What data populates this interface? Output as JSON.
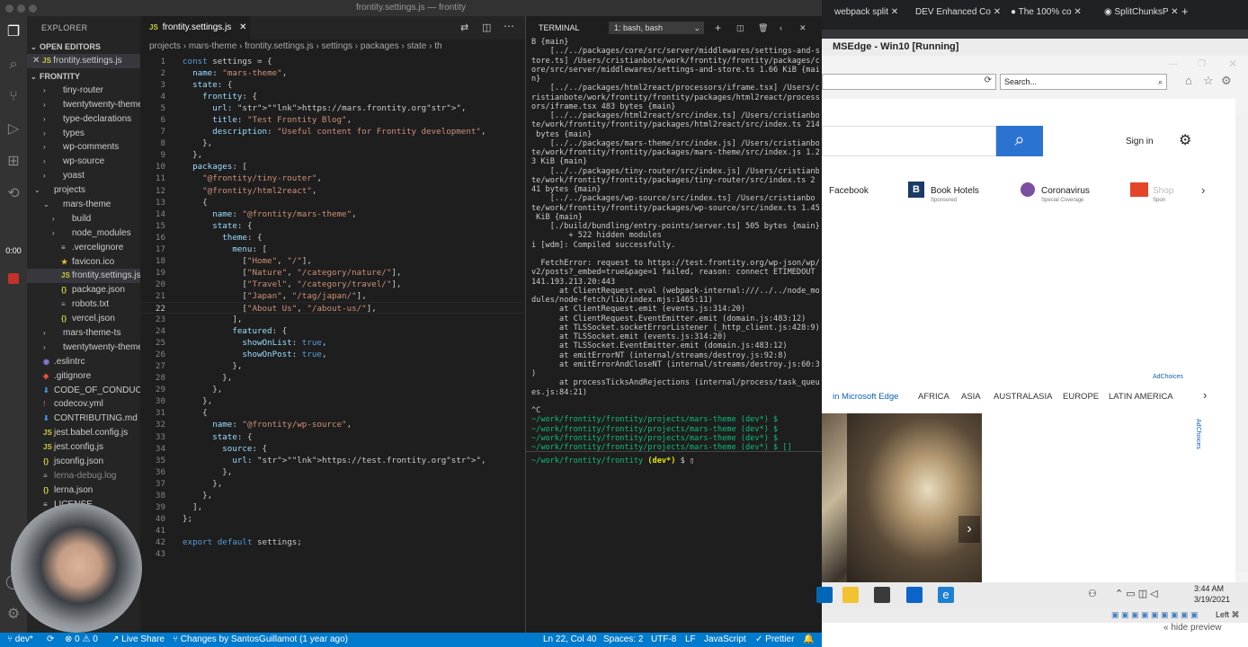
{
  "window_title": "frontity.settings.js — frontity",
  "explorer": {
    "title": "EXPLORER",
    "open_editors_label": "OPEN EDITORS",
    "open_editor_file": "frontity.settings.js",
    "project_label": "FRONTITY",
    "items": [
      {
        "label": "tiny-router",
        "depth": 1,
        "type": "folder-closed"
      },
      {
        "label": "twentytwenty-theme",
        "depth": 1,
        "type": "folder-closed"
      },
      {
        "label": "type-declarations",
        "depth": 1,
        "type": "folder-closed"
      },
      {
        "label": "types",
        "depth": 1,
        "type": "folder-closed"
      },
      {
        "label": "wp-comments",
        "depth": 1,
        "type": "folder-closed"
      },
      {
        "label": "wp-source",
        "depth": 1,
        "type": "folder-closed"
      },
      {
        "label": "yoast",
        "depth": 1,
        "type": "folder-closed"
      },
      {
        "label": "projects",
        "depth": 0,
        "type": "folder-open"
      },
      {
        "label": "mars-theme",
        "depth": 1,
        "type": "folder-open"
      },
      {
        "label": "build",
        "depth": 2,
        "type": "folder-closed"
      },
      {
        "label": "node_modules",
        "depth": 2,
        "type": "folder-closed"
      },
      {
        "label": ".vercelignore",
        "depth": 2,
        "type": "file"
      },
      {
        "label": "favicon.ico",
        "depth": 2,
        "type": "star"
      },
      {
        "label": "frontity.settings.js",
        "depth": 2,
        "type": "js",
        "selected": true
      },
      {
        "label": "package.json",
        "depth": 2,
        "type": "json"
      },
      {
        "label": "robots.txt",
        "depth": 2,
        "type": "txt"
      },
      {
        "label": "vercel.json",
        "depth": 2,
        "type": "json"
      },
      {
        "label": "mars-theme-ts",
        "depth": 1,
        "type": "folder-closed"
      },
      {
        "label": "twentytwenty-theme",
        "depth": 1,
        "type": "folder-closed"
      },
      {
        "label": ".eslintrc",
        "depth": 0,
        "type": "eslint"
      },
      {
        "label": ".gitignore",
        "depth": 0,
        "type": "git"
      },
      {
        "label": "CODE_OF_CONDUC...",
        "depth": 0,
        "type": "md"
      },
      {
        "label": "codecov.yml",
        "depth": 0,
        "type": "yml"
      },
      {
        "label": "CONTRIBUTING.md",
        "depth": 0,
        "type": "md"
      },
      {
        "label": "jest.babel.config.js",
        "depth": 0,
        "type": "js"
      },
      {
        "label": "jest.config.js",
        "depth": 0,
        "type": "js"
      },
      {
        "label": "jsconfig.json",
        "depth": 0,
        "type": "json"
      },
      {
        "label": "lerna-debug.log",
        "depth": 0,
        "type": "log"
      },
      {
        "label": "lerna.json",
        "depth": 0,
        "type": "json"
      },
      {
        "label": "LICENSE",
        "depth": 0,
        "type": "file"
      }
    ]
  },
  "timer": "0:00",
  "editor": {
    "tab_label": "frontity.settings.js",
    "breadcrumb": [
      "projects",
      "mars-theme",
      "frontity.settings.js",
      "settings",
      "packages",
      "state",
      "th"
    ],
    "current_line": 22,
    "lines": [
      "const settings = {",
      "  name: \"mars-theme\",",
      "  state: {",
      "    frontity: {",
      "      url: \"https://mars.frontity.org\",",
      "      title: \"Test Frontity Blog\",",
      "      description: \"Useful content for Frontity development\",",
      "    },",
      "  },",
      "  packages: [",
      "    \"@frontity/tiny-router\",",
      "    \"@frontity/html2react\",",
      "    {",
      "      name: \"@frontity/mars-theme\",",
      "      state: {",
      "        theme: {",
      "          menu: [",
      "            [\"Home\", \"/\"],",
      "            [\"Nature\", \"/category/nature/\"],",
      "            [\"Travel\", \"/category/travel/\"],",
      "            [\"Japan\", \"/tag/japan/\"],",
      "            [\"About Us\", \"/about-us/\"],",
      "          ],",
      "          featured: {",
      "            showOnList: true,",
      "            showOnPost: true,",
      "          },",
      "        },",
      "      },",
      "    },",
      "    {",
      "      name: \"@frontity/wp-source\",",
      "      state: {",
      "        source: {",
      "          url: \"https://test.frontity.org\",",
      "        },",
      "      },",
      "    },",
      "  ],",
      "};",
      "",
      "export default settings;",
      ""
    ]
  },
  "terminal": {
    "title": "TERMINAL",
    "shell": "1: bash, bash",
    "lines": [
      "B {main}",
      "    [../../packages/core/src/server/middlewares/settings-and-s",
      "tore.ts] /Users/cristianbote/work/frontity/frontity/packages/c",
      "ore/src/server/middlewares/settings-and-store.ts 1.66 KiB {mai",
      "n}",
      "    [../../packages/html2react/processors/iframe.tsx] /Users/c",
      "ristianbote/work/frontity/frontity/packages/html2react/process",
      "ors/iframe.tsx 483 bytes {main}",
      "    [../../packages/html2react/src/index.ts] /Users/cristianbo",
      "te/work/frontity/frontity/packages/html2react/src/index.ts 214",
      " bytes {main}",
      "    [../../packages/mars-theme/src/index.js] /Users/cristianbo",
      "te/work/frontity/frontity/packages/mars-theme/src/index.js 1.2",
      "3 KiB {main}",
      "    [../../packages/tiny-router/src/index.js] /Users/cristianbo",
      "te/work/frontity/frontity/packages/tiny-router/src/index.ts 2",
      "41 bytes {main}",
      "    [../../packages/wp-source/src/index.ts] /Users/cristianbo",
      "te/work/frontity/frontity/packages/wp-source/src/index.ts 1.45",
      " KiB {main}",
      "    [./build/bundling/entry-points/server.ts] 505 bytes {main}",
      "        + 522 hidden modules",
      "i [wdm]: Compiled successfully.",
      "",
      "  FetchError: request to https://test.frontity.org/wp-json/wp/",
      "v2/posts?_embed=true&page=1 failed, reason: connect ETIMEDOUT",
      "141.193.213.20:443",
      "      at ClientRequest.eval (webpack-internal:///../../node_mo",
      "dules/node-fetch/lib/index.mjs:1465:11)",
      "      at ClientRequest.emit (events.js:314:20)",
      "      at ClientRequest.EventEmitter.emit (domain.js:483:12)",
      "      at TLSSocket.socketErrorListener (_http_client.js:428:9)",
      "      at TLSSocket.emit (events.js:314:20)",
      "      at TLSSocket.EventEmitter.emit (domain.js:483:12)",
      "      at emitErrorNT (internal/streams/destroy.js:92:8)",
      "      at emitErrorAndCloseNT (internal/streams/destroy.js:60:3",
      ")",
      "      at processTicksAndRejections (internal/process/task_queu",
      "es.js:84:21)",
      "",
      "^C",
      "~/work/frontity/frontity/projects/mars-theme (dev*) $",
      "~/work/frontity/frontity/projects/mars-theme (dev*) $",
      "~/work/frontity/frontity/projects/mars-theme (dev*) $",
      "~/work/frontity/frontity/projects/mars-theme (dev*) $ []"
    ],
    "second_prompt": "~/work/frontity/frontity (dev*) $ []"
  },
  "statusbar": {
    "branch": "dev*",
    "sync": "0",
    "errors": "0",
    "live_share": "Live Share",
    "blame": "Changes by SantosGuillamot (1 year ago)",
    "position": "Ln 22, Col 40",
    "spaces": "Spaces: 2",
    "encoding": "UTF-8",
    "eol": "LF",
    "language": "JavaScript",
    "formatter": "Prettier"
  },
  "browser": {
    "tabs": [
      "webpack split",
      "Enhanced Co",
      "The 100% co",
      "SplitChunksP"
    ],
    "vm_title": "MSEdge - Win10 [Running]",
    "search_placeholder": "Search...",
    "sign_in": "Sign in",
    "shortcuts": [
      {
        "label": "Facebook",
        "sub": ""
      },
      {
        "label": "Book Hotels",
        "sub": "Sponsored"
      },
      {
        "label": "Coronavirus",
        "sub": "Special Coverage"
      },
      {
        "label": "Shop",
        "sub": "Spon"
      }
    ],
    "adchoices": "AdChoices",
    "region_intro": "in Microsoft Edge",
    "regions": [
      "AFRICA",
      "ASIA",
      "AUSTRALASIA",
      "EUROPE",
      "LATIN AMERICA"
    ],
    "clock_time": "3:44 AM",
    "clock_date": "3/19/2021",
    "left_key": "Left ⌘",
    "hide_preview": "« hide preview"
  }
}
